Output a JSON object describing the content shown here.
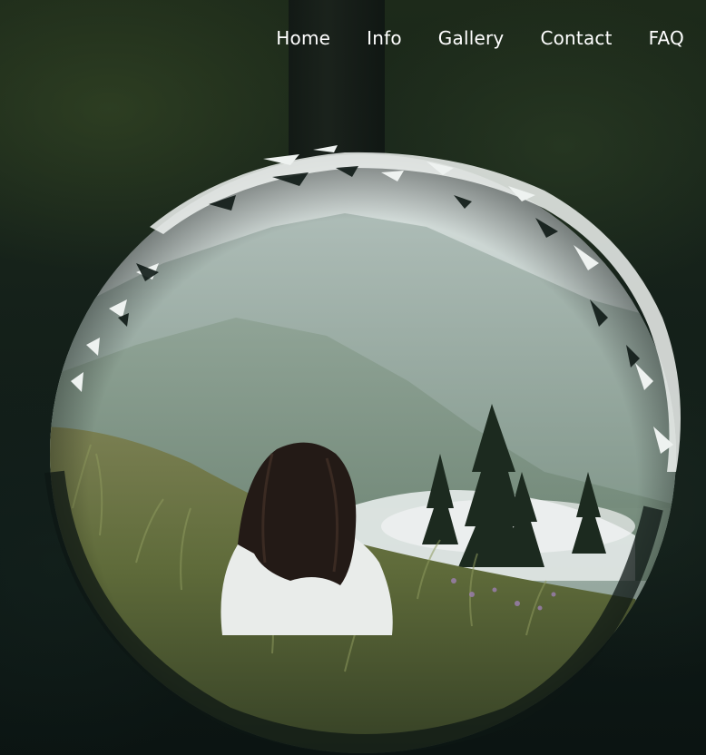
{
  "nav": {
    "items": [
      {
        "label": "Home"
      },
      {
        "label": "Info"
      },
      {
        "label": "Gallery"
      },
      {
        "label": "Contact"
      },
      {
        "label": "FAQ"
      }
    ]
  },
  "hero": {
    "image_subject": "woman-sitting-in-mountain-meadow"
  },
  "colors": {
    "background": "#0c1512",
    "nav_text": "#ffffff",
    "mist": "#c9d3cf",
    "grass": "#5f6b3a"
  }
}
